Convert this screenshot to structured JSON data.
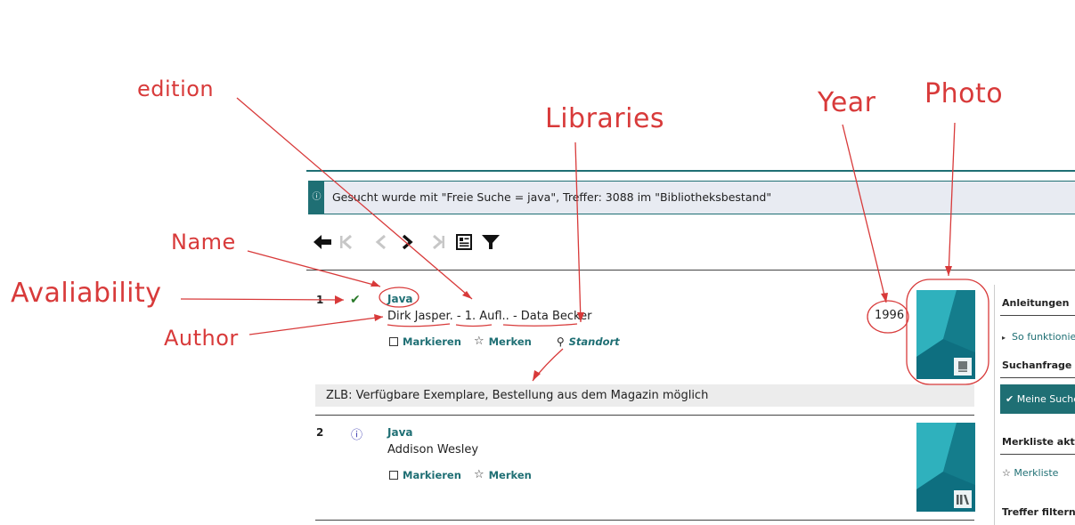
{
  "info": {
    "text": "Gesucht wurde mit \"Freie Suche = java\", Treffer: 3088 im \"Bibliotheksbestand\""
  },
  "toolbar": {
    "icons": [
      "back-arrow-icon",
      "first-page-icon",
      "prev-icon",
      "next-icon",
      "last-page-icon",
      "detail-view-icon",
      "filter-icon"
    ]
  },
  "results": [
    {
      "num": "1",
      "title": "Java",
      "meta": "Dirk Jasper. - 1. Aufl.. - Data Becker",
      "year": "1996",
      "markieren": "Markieren",
      "merken": "Merken",
      "standort": "Standort",
      "availability": "ZLB: Verfügbare Exemplare, Bestellung aus dem Magazin möglich"
    },
    {
      "num": "2",
      "title": "Java",
      "meta": "Addison Wesley",
      "markieren": "Markieren",
      "merken": "Merken"
    }
  ],
  "sidebar": {
    "anleitungen": "Anleitungen",
    "so_funktioniert": "So funktionie",
    "suchanfrage": "Suchanfrage sic",
    "meine_suche": "Meine Suche",
    "merkliste_aktiv": "Merkliste aktiv",
    "merkliste": "Merkliste",
    "treffer_filtern": "Treffer filtern"
  },
  "annotations": {
    "edition": "edition",
    "libraries": "Libraries",
    "year": "Year",
    "photo": "Photo",
    "name": "Name",
    "availability": "Avaliability",
    "author": "Author"
  },
  "colors": {
    "accent": "#1f6f74",
    "annotation": "#d83a3a",
    "available_check": "#2a7a2a",
    "info_icon": "#3a3ab0"
  }
}
